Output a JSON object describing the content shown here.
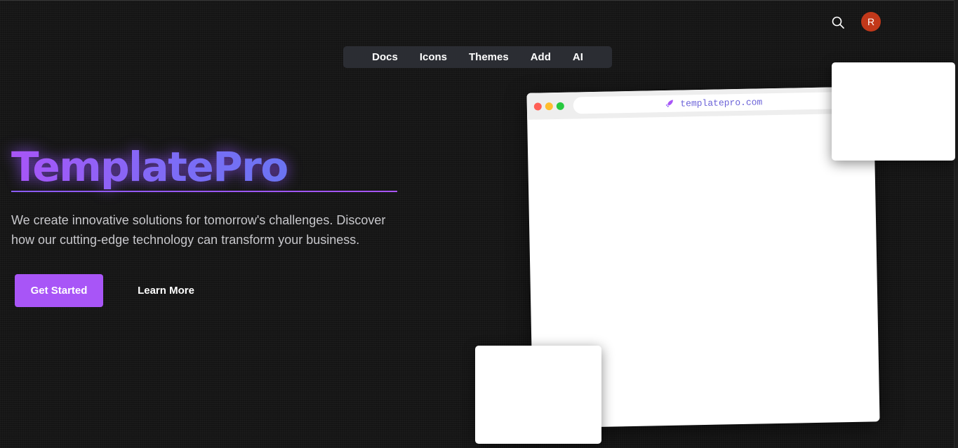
{
  "header": {
    "search_icon": "search-icon",
    "avatar_initial": "R",
    "avatar_color": "#c2381a"
  },
  "nav": {
    "items": [
      "Docs",
      "Icons",
      "Themes",
      "Add",
      "AI"
    ]
  },
  "hero": {
    "title": "TemplatePro",
    "description": "We create innovative solutions for tomorrow's challenges. Discover how our cutting-edge technology can transform your business.",
    "primary_button": "Get Started",
    "secondary_button": "Learn More",
    "accent_color": "#a855f7"
  },
  "preview": {
    "url": "templatepro.com",
    "url_icon": "rocket-icon"
  }
}
